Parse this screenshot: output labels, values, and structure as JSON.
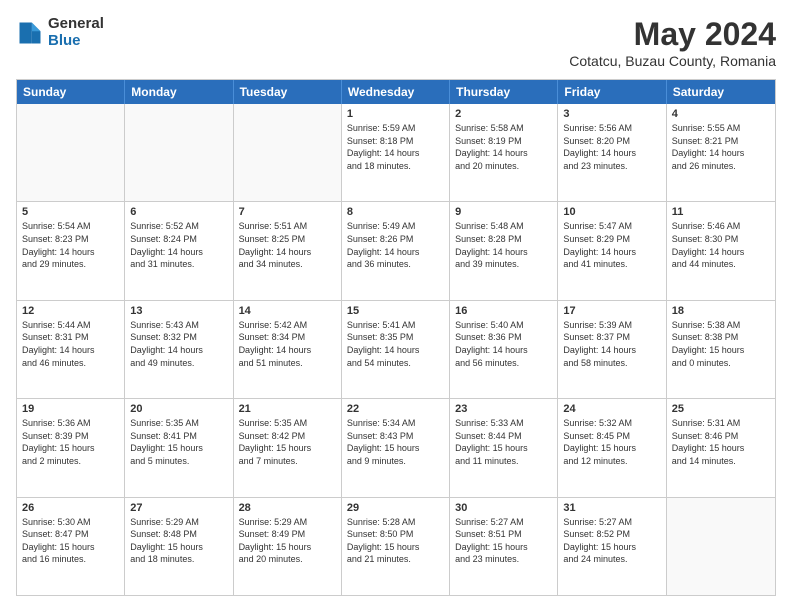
{
  "logo": {
    "general": "General",
    "blue": "Blue"
  },
  "title": "May 2024",
  "subtitle": "Cotatcu, Buzau County, Romania",
  "header_days": [
    "Sunday",
    "Monday",
    "Tuesday",
    "Wednesday",
    "Thursday",
    "Friday",
    "Saturday"
  ],
  "weeks": [
    [
      {
        "day": "",
        "info": ""
      },
      {
        "day": "",
        "info": ""
      },
      {
        "day": "",
        "info": ""
      },
      {
        "day": "1",
        "info": "Sunrise: 5:59 AM\nSunset: 8:18 PM\nDaylight: 14 hours\nand 18 minutes."
      },
      {
        "day": "2",
        "info": "Sunrise: 5:58 AM\nSunset: 8:19 PM\nDaylight: 14 hours\nand 20 minutes."
      },
      {
        "day": "3",
        "info": "Sunrise: 5:56 AM\nSunset: 8:20 PM\nDaylight: 14 hours\nand 23 minutes."
      },
      {
        "day": "4",
        "info": "Sunrise: 5:55 AM\nSunset: 8:21 PM\nDaylight: 14 hours\nand 26 minutes."
      }
    ],
    [
      {
        "day": "5",
        "info": "Sunrise: 5:54 AM\nSunset: 8:23 PM\nDaylight: 14 hours\nand 29 minutes."
      },
      {
        "day": "6",
        "info": "Sunrise: 5:52 AM\nSunset: 8:24 PM\nDaylight: 14 hours\nand 31 minutes."
      },
      {
        "day": "7",
        "info": "Sunrise: 5:51 AM\nSunset: 8:25 PM\nDaylight: 14 hours\nand 34 minutes."
      },
      {
        "day": "8",
        "info": "Sunrise: 5:49 AM\nSunset: 8:26 PM\nDaylight: 14 hours\nand 36 minutes."
      },
      {
        "day": "9",
        "info": "Sunrise: 5:48 AM\nSunset: 8:28 PM\nDaylight: 14 hours\nand 39 minutes."
      },
      {
        "day": "10",
        "info": "Sunrise: 5:47 AM\nSunset: 8:29 PM\nDaylight: 14 hours\nand 41 minutes."
      },
      {
        "day": "11",
        "info": "Sunrise: 5:46 AM\nSunset: 8:30 PM\nDaylight: 14 hours\nand 44 minutes."
      }
    ],
    [
      {
        "day": "12",
        "info": "Sunrise: 5:44 AM\nSunset: 8:31 PM\nDaylight: 14 hours\nand 46 minutes."
      },
      {
        "day": "13",
        "info": "Sunrise: 5:43 AM\nSunset: 8:32 PM\nDaylight: 14 hours\nand 49 minutes."
      },
      {
        "day": "14",
        "info": "Sunrise: 5:42 AM\nSunset: 8:34 PM\nDaylight: 14 hours\nand 51 minutes."
      },
      {
        "day": "15",
        "info": "Sunrise: 5:41 AM\nSunset: 8:35 PM\nDaylight: 14 hours\nand 54 minutes."
      },
      {
        "day": "16",
        "info": "Sunrise: 5:40 AM\nSunset: 8:36 PM\nDaylight: 14 hours\nand 56 minutes."
      },
      {
        "day": "17",
        "info": "Sunrise: 5:39 AM\nSunset: 8:37 PM\nDaylight: 14 hours\nand 58 minutes."
      },
      {
        "day": "18",
        "info": "Sunrise: 5:38 AM\nSunset: 8:38 PM\nDaylight: 15 hours\nand 0 minutes."
      }
    ],
    [
      {
        "day": "19",
        "info": "Sunrise: 5:36 AM\nSunset: 8:39 PM\nDaylight: 15 hours\nand 2 minutes."
      },
      {
        "day": "20",
        "info": "Sunrise: 5:35 AM\nSunset: 8:41 PM\nDaylight: 15 hours\nand 5 minutes."
      },
      {
        "day": "21",
        "info": "Sunrise: 5:35 AM\nSunset: 8:42 PM\nDaylight: 15 hours\nand 7 minutes."
      },
      {
        "day": "22",
        "info": "Sunrise: 5:34 AM\nSunset: 8:43 PM\nDaylight: 15 hours\nand 9 minutes."
      },
      {
        "day": "23",
        "info": "Sunrise: 5:33 AM\nSunset: 8:44 PM\nDaylight: 15 hours\nand 11 minutes."
      },
      {
        "day": "24",
        "info": "Sunrise: 5:32 AM\nSunset: 8:45 PM\nDaylight: 15 hours\nand 12 minutes."
      },
      {
        "day": "25",
        "info": "Sunrise: 5:31 AM\nSunset: 8:46 PM\nDaylight: 15 hours\nand 14 minutes."
      }
    ],
    [
      {
        "day": "26",
        "info": "Sunrise: 5:30 AM\nSunset: 8:47 PM\nDaylight: 15 hours\nand 16 minutes."
      },
      {
        "day": "27",
        "info": "Sunrise: 5:29 AM\nSunset: 8:48 PM\nDaylight: 15 hours\nand 18 minutes."
      },
      {
        "day": "28",
        "info": "Sunrise: 5:29 AM\nSunset: 8:49 PM\nDaylight: 15 hours\nand 20 minutes."
      },
      {
        "day": "29",
        "info": "Sunrise: 5:28 AM\nSunset: 8:50 PM\nDaylight: 15 hours\nand 21 minutes."
      },
      {
        "day": "30",
        "info": "Sunrise: 5:27 AM\nSunset: 8:51 PM\nDaylight: 15 hours\nand 23 minutes."
      },
      {
        "day": "31",
        "info": "Sunrise: 5:27 AM\nSunset: 8:52 PM\nDaylight: 15 hours\nand 24 minutes."
      },
      {
        "day": "",
        "info": ""
      }
    ]
  ]
}
